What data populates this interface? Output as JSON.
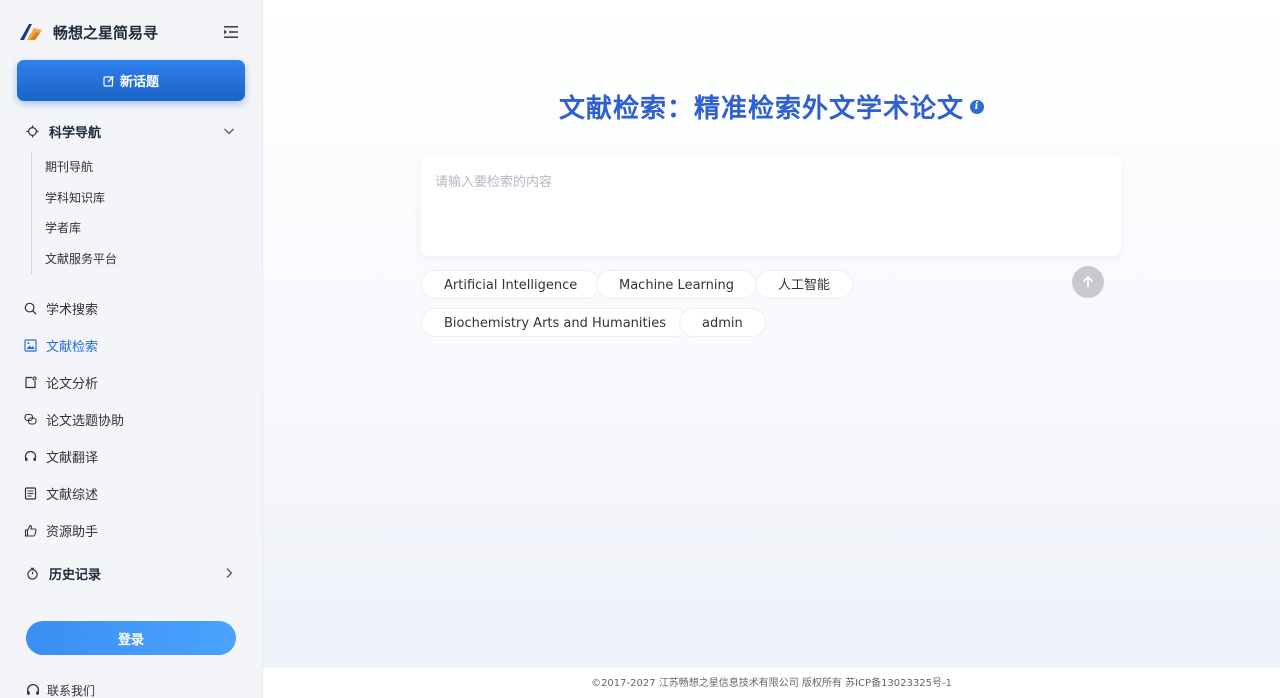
{
  "sidebar": {
    "brand_title": "畅想之星简易寻",
    "new_topic_label": "新话题",
    "science_nav": {
      "label": "科学导航",
      "items": [
        "期刊导航",
        "学科知识库",
        "学者库",
        "文献服务平台"
      ]
    },
    "nav_items": [
      {
        "label": "学术搜索",
        "icon": "search-icon"
      },
      {
        "label": "文献检索",
        "icon": "image-icon",
        "active": true
      },
      {
        "label": "论文分析",
        "icon": "document-icon"
      },
      {
        "label": "论文选题协助",
        "icon": "chat-bubbles-icon"
      },
      {
        "label": "文献翻译",
        "icon": "headset-icon"
      },
      {
        "label": "文献综述",
        "icon": "list-document-icon"
      },
      {
        "label": "资源助手",
        "icon": "thumbs-up-icon"
      }
    ],
    "history_label": "历史记录",
    "login_label": "登录",
    "contact_label": "联系我们"
  },
  "main": {
    "title": "文献检索：精准检索外文学术论文",
    "search_placeholder": "请输入要检索的内容",
    "suggestions": [
      "Artificial Intelligence",
      "Machine Learning",
      "人工智能",
      "Biochemistry Arts and Humanities",
      "admin"
    ]
  },
  "footer": {
    "copyright": "©2017-2027 江苏畅想之星信息技术有限公司 版权所有 苏ICP备13023325号-1"
  },
  "colors": {
    "accent": "#2f5fd0",
    "button_blue": "#1c64c9",
    "active_nav": "#2a6bd6",
    "sidebar_bg": "#f3f5f9"
  }
}
